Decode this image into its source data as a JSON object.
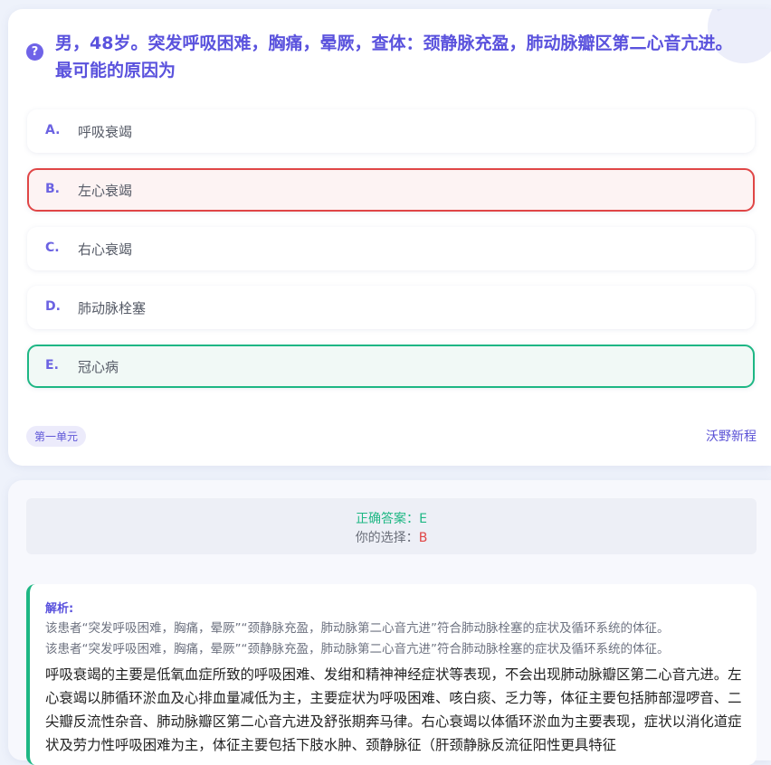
{
  "question": {
    "icon": "question-mark-icon",
    "text": "男，48岁。突发呼吸困难，胸痛，晕厥，查体：颈静脉充盈，肺动脉瓣区第二心音亢进。最可能的原因为"
  },
  "options": [
    {
      "letter": "A.",
      "text": "呼吸衰竭",
      "state": "normal"
    },
    {
      "letter": "B.",
      "text": "左心衰竭",
      "state": "wrong"
    },
    {
      "letter": "C.",
      "text": "右心衰竭",
      "state": "normal"
    },
    {
      "letter": "D.",
      "text": "肺动脉栓塞",
      "state": "normal"
    },
    {
      "letter": "E.",
      "text": "冠心病",
      "state": "correct"
    }
  ],
  "footer": {
    "chapter": "第一单元",
    "source": "沃野新程"
  },
  "result": {
    "correct_label": "正确答案：",
    "correct_value": "E",
    "choice_label": "你的选择：",
    "choice_value": "B"
  },
  "analysis": {
    "title": "解析:",
    "line1": "该患者“突发呼吸困难，胸痛，晕厥”“颈静脉充盈，肺动脉第二心音亢进”符合肺动脉栓塞的症状及循环系统的体征。",
    "line2": "该患者“突发呼吸困难，胸痛，晕厥”“颈静脉充盈，肺动脉第二心音亢进”符合肺动脉栓塞的症状及循环系统的体征。",
    "body": "呼吸衰竭的主要是低氧血症所致的呼吸困难、发绀和精神神经症状等表现，不会出现肺动脉瓣区第二心音亢进。左心衰竭以肺循环淤血及心排血量减低为主，主要症状为呼吸困难、咳白痰、乏力等，体征主要包括肺部湿啰音、二尖瓣反流性杂音、肺动脉瓣区第二心音亢进及舒张期奔马律。右心衰竭以体循环淤血为主要表现，症状以消化道症状及劳力性呼吸困难为主，体征主要包括下肢水肿、颈静脉征（肝颈静脉反流征阳性更具特征"
  },
  "colors": {
    "accent": "#5a52dd",
    "wrong": "#e04646",
    "correct": "#1eb784"
  }
}
